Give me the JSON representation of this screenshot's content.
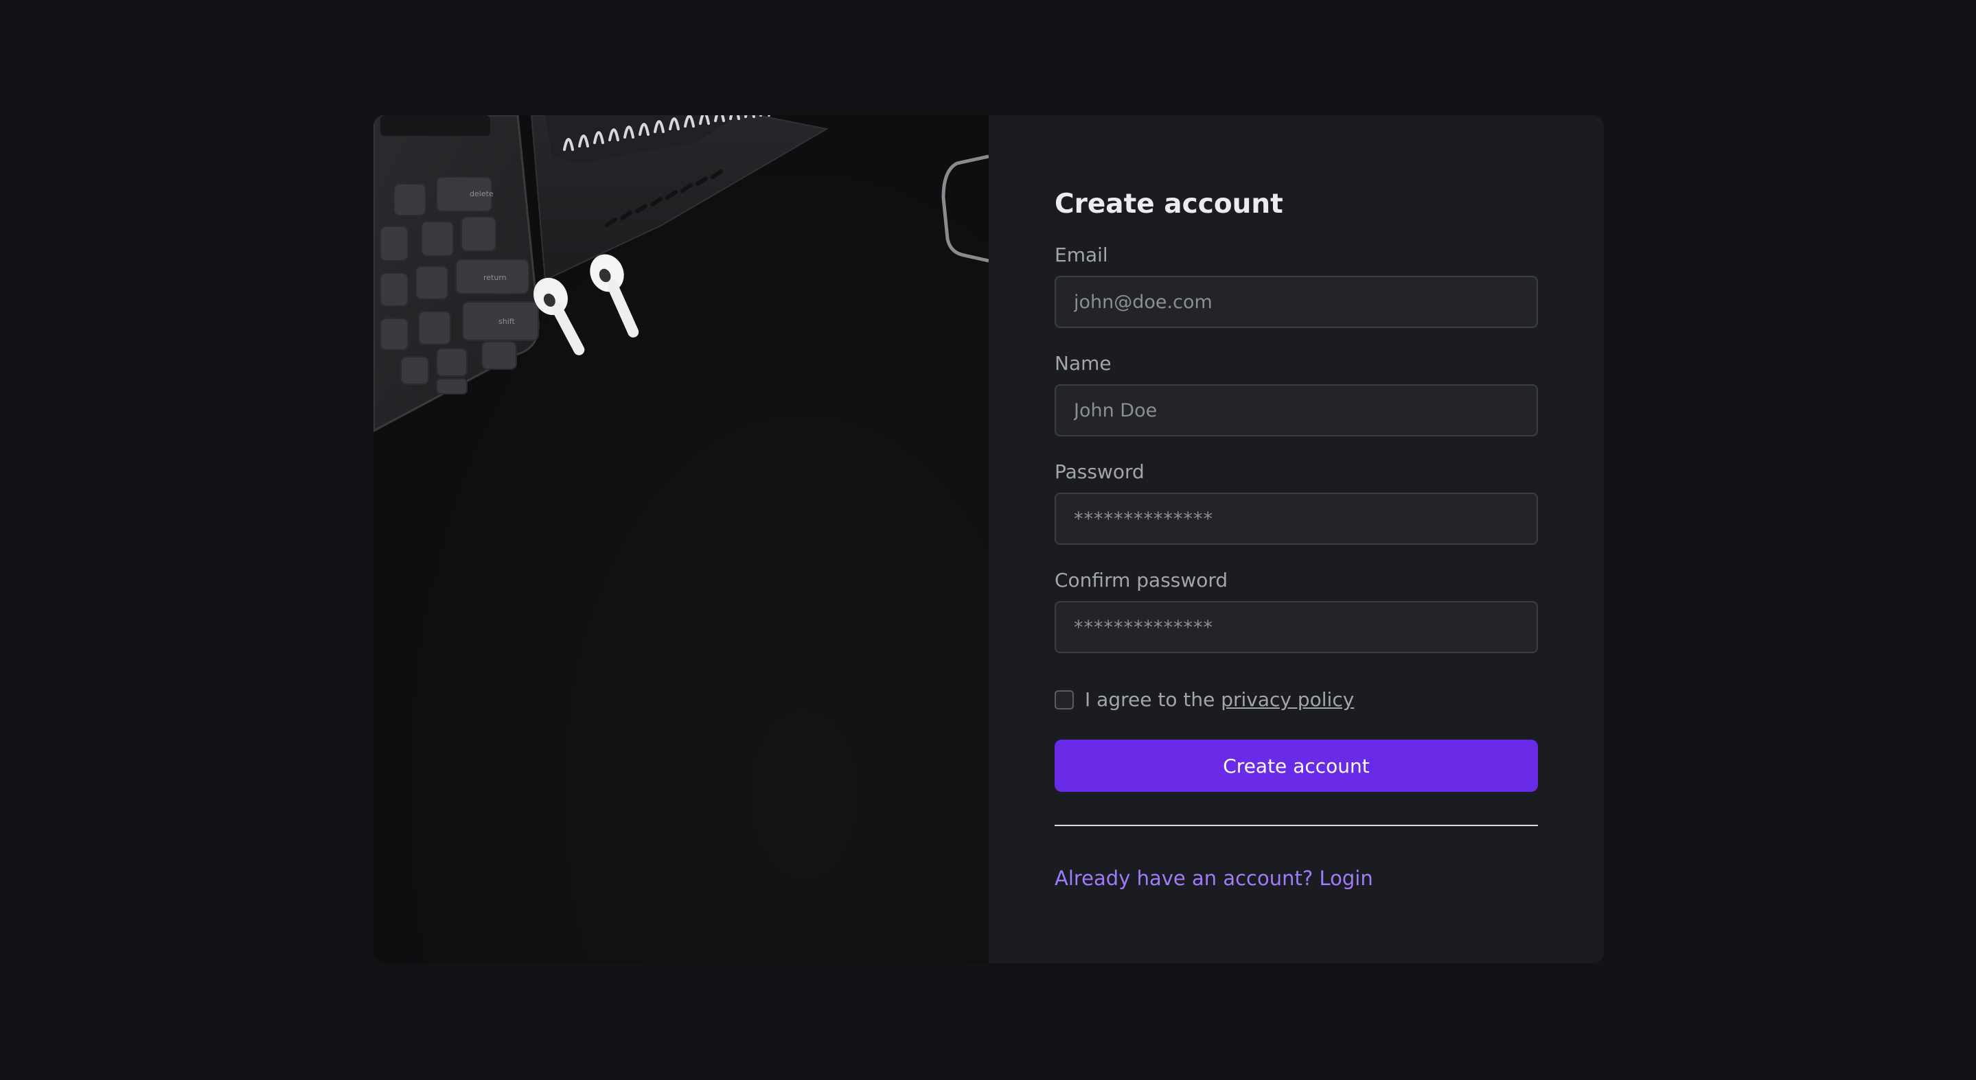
{
  "form": {
    "title": "Create account",
    "fields": [
      {
        "label": "Email",
        "placeholder": "john@doe.com",
        "type": "email"
      },
      {
        "label": "Name",
        "placeholder": "John Doe",
        "type": "text"
      },
      {
        "label": "Password",
        "placeholder": "**************",
        "type": "password"
      },
      {
        "label": "Confirm password",
        "placeholder": "**************",
        "type": "password"
      }
    ],
    "agree_prefix": "I agree to the ",
    "policy_link": "privacy policy",
    "agree_checked": false,
    "submit_label": "Create account",
    "login_link": "Already have an account? Login"
  },
  "hero": {
    "keyboard_keys": [
      "delete",
      "return",
      "shift"
    ]
  },
  "colors": {
    "page_bg": "#121317",
    "panel_bg": "#1b1c21",
    "input_bg": "#23242a",
    "accent": "#6a2be8",
    "link": "#a07cf6"
  }
}
